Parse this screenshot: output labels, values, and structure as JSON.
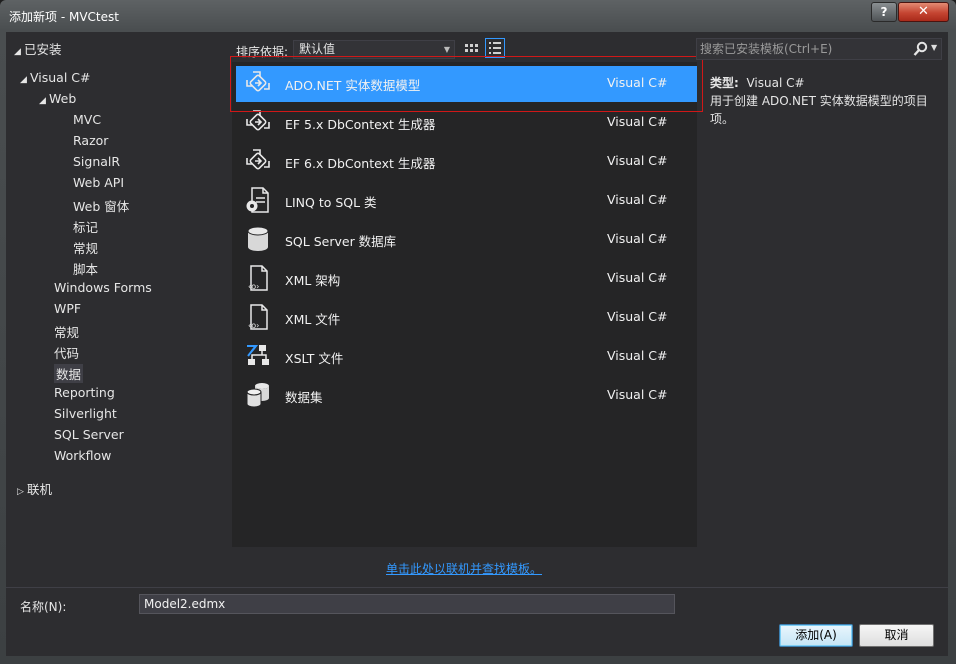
{
  "window": {
    "title": "添加新项 - MVCtest",
    "help_label": "?",
    "close_label": "✕"
  },
  "tree": {
    "installed": "已安装",
    "visual_csharp": "Visual C#",
    "web": "Web",
    "web_children": [
      "MVC",
      "Razor",
      "SignalR",
      "Web API",
      "Web 窗体",
      "标记",
      "常规",
      "脚本"
    ],
    "csharp_children": [
      "Windows Forms",
      "WPF",
      "常规",
      "代码",
      "数据",
      "Reporting",
      "Silverlight",
      "SQL Server",
      "Workflow"
    ],
    "selected": "数据",
    "online": "联机"
  },
  "toolbar": {
    "sort_label": "排序依据:",
    "sort_value": "默认值"
  },
  "templates": [
    {
      "name": "ADO.NET 实体数据模型",
      "type": "Visual C#",
      "icon": "entity-model-icon",
      "selected": true
    },
    {
      "name": "EF 5.x DbContext 生成器",
      "type": "Visual C#",
      "icon": "entity-model-icon"
    },
    {
      "name": "EF 6.x DbContext 生成器",
      "type": "Visual C#",
      "icon": "entity-model-icon"
    },
    {
      "name": "LINQ to SQL 类",
      "type": "Visual C#",
      "icon": "linq-sql-icon"
    },
    {
      "name": "SQL Server 数据库",
      "type": "Visual C#",
      "icon": "database-icon"
    },
    {
      "name": "XML 架构",
      "type": "Visual C#",
      "icon": "xml-file-icon"
    },
    {
      "name": "XML 文件",
      "type": "Visual C#",
      "icon": "xml-file-icon"
    },
    {
      "name": "XSLT 文件",
      "type": "Visual C#",
      "icon": "xslt-icon"
    },
    {
      "name": "数据集",
      "type": "Visual C#",
      "icon": "dataset-icon"
    }
  ],
  "online_link": "单击此处以联机并查找模板。",
  "search": {
    "placeholder": "搜索已安装模板(Ctrl+E)"
  },
  "details": {
    "type_key": "类型:",
    "type_value": "Visual C#",
    "description": "用于创建 ADO.NET 实体数据模型的项目项。"
  },
  "name_field": {
    "label": "名称(N):",
    "value": "Model2.edmx"
  },
  "buttons": {
    "add": "添加(A)",
    "cancel": "取消"
  },
  "colors": {
    "selection": "#3399ff",
    "highlight_box": "#d01818",
    "link": "#3399ff"
  }
}
